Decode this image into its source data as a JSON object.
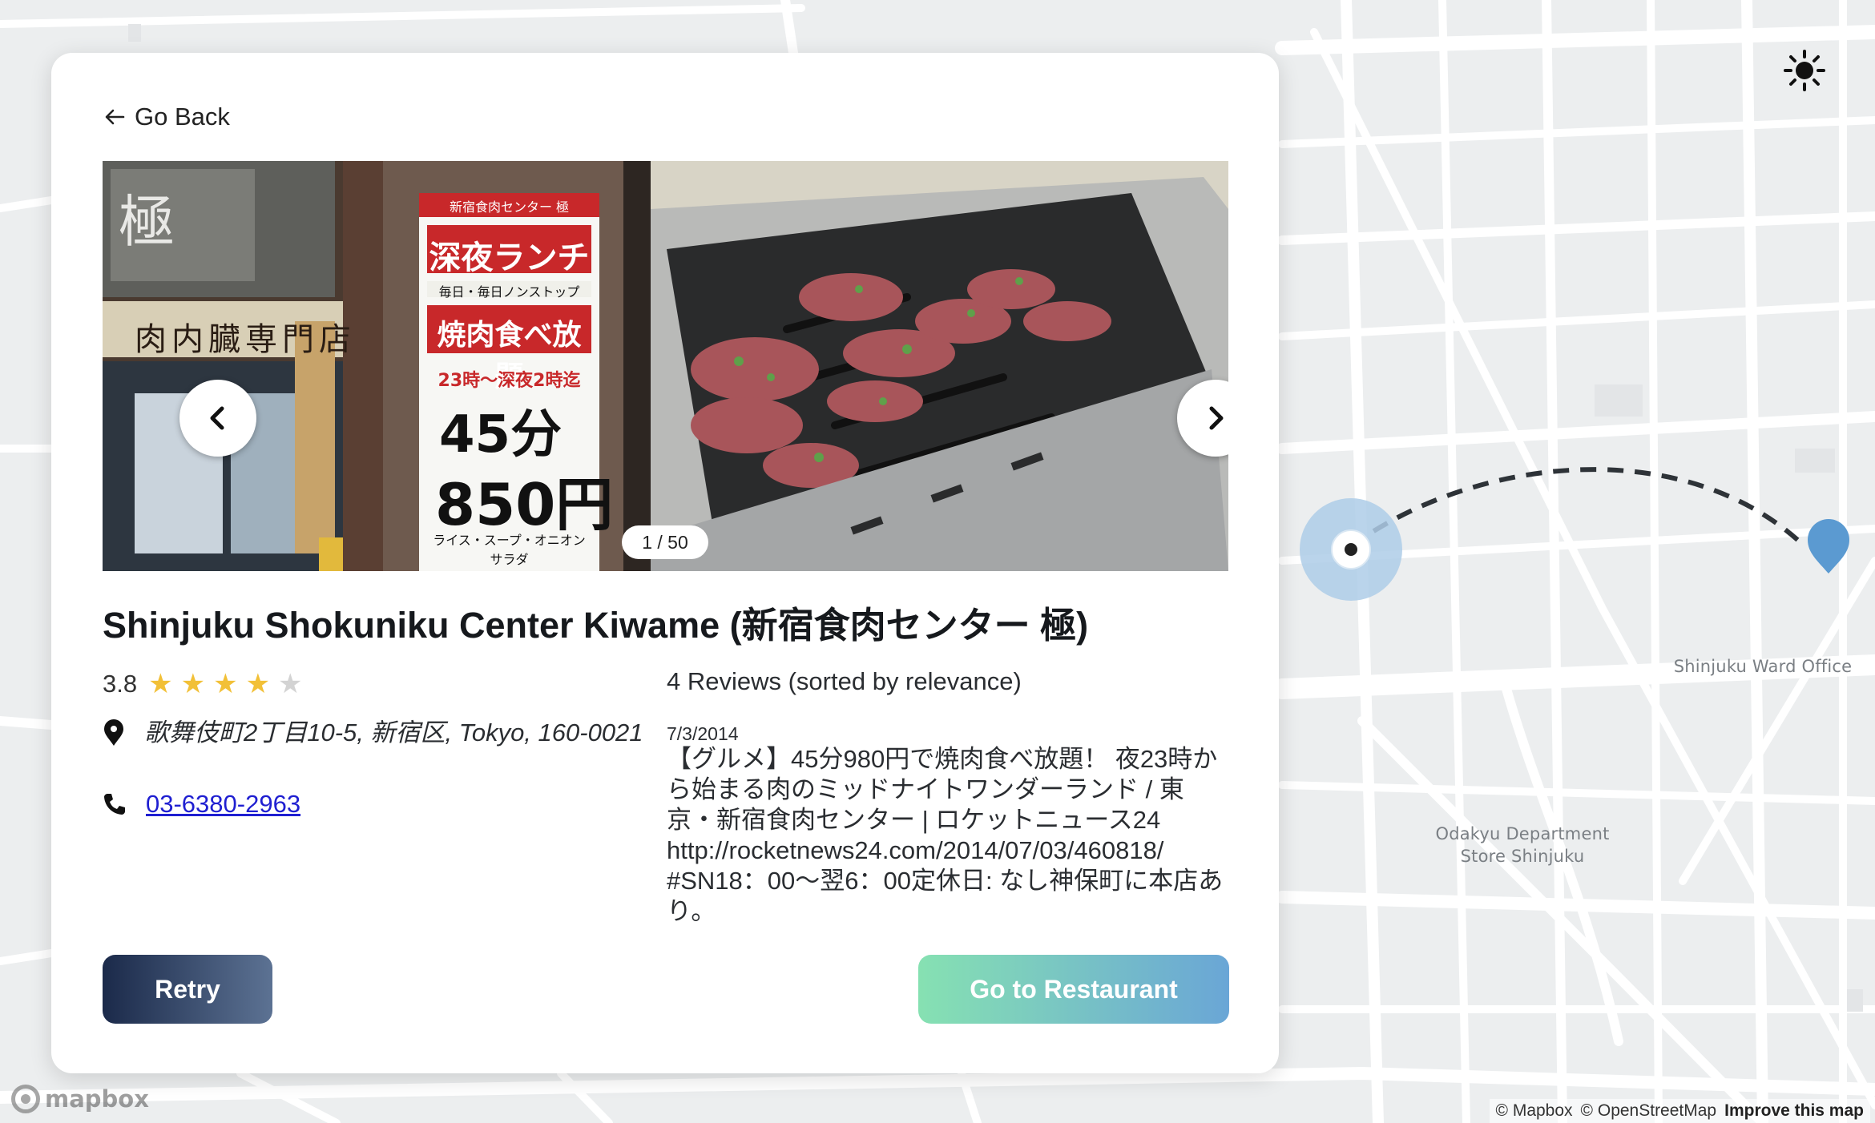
{
  "map": {
    "labels": {
      "ward_office": "Shinjuku Ward Office",
      "odakyu": "Odakyu Department Store Shinjuku"
    },
    "mapbox_logo": "mapbox",
    "attribution": {
      "mapbox": "© Mapbox",
      "osm": "© OpenStreetMap",
      "improve": "Improve this map"
    },
    "theme_icon": "sun-icon"
  },
  "card": {
    "go_back_label": "Go Back",
    "gallery": {
      "counter": "1 / 50",
      "prev_icon": "chevron-left-icon",
      "next_icon": "chevron-right-icon",
      "left_photo_sign_lines": [
        "深夜ランチ",
        "毎日・毎日ノンストップ",
        "焼肉食べ放題",
        "23時〜深夜2時迄",
        "45分",
        "850円",
        "ライス・スープ・オニオンサラダ"
      ],
      "left_photo_header": "新宿食肉センター 極",
      "left_photo_kanji": "極",
      "left_photo_shop_sign": "肉内臓専門店"
    },
    "restaurant": {
      "name": "Shinjuku Shokuniku Center Kiwame (新宿食肉センター 極)",
      "rating": "3.8",
      "stars_filled": 4,
      "stars_total": 5,
      "address": "歌舞伎町2丁目10-5, 新宿区, Tokyo, 160-0021",
      "phone": "03-6380-2963"
    },
    "reviews": {
      "heading": "4 Reviews (sorted by relevance)",
      "first": {
        "date": "7/3/2014",
        "text": "【グルメ】45分980円で焼肉食べ放題！ 夜23時から始まる肉のミッドナイトワンダーランド / 東京・新宿食肉センター | ロケットニュース24 http://rocketnews24.com/2014/07/03/460818/ #SN18：00〜翌6：00定休日: なし神保町に本店あり。"
      }
    },
    "buttons": {
      "retry": "Retry",
      "go_to_restaurant": "Go to Restaurant"
    }
  },
  "colors": {
    "star": "#f2c037",
    "retry_gradient": [
      "#1b2a4a",
      "#5c7293"
    ],
    "go_gradient": [
      "#86e1b2",
      "#6aa6d6"
    ],
    "route": "#2e3338",
    "destination_pin": "#5b9ad1",
    "origin_halo": "#aecde8"
  }
}
